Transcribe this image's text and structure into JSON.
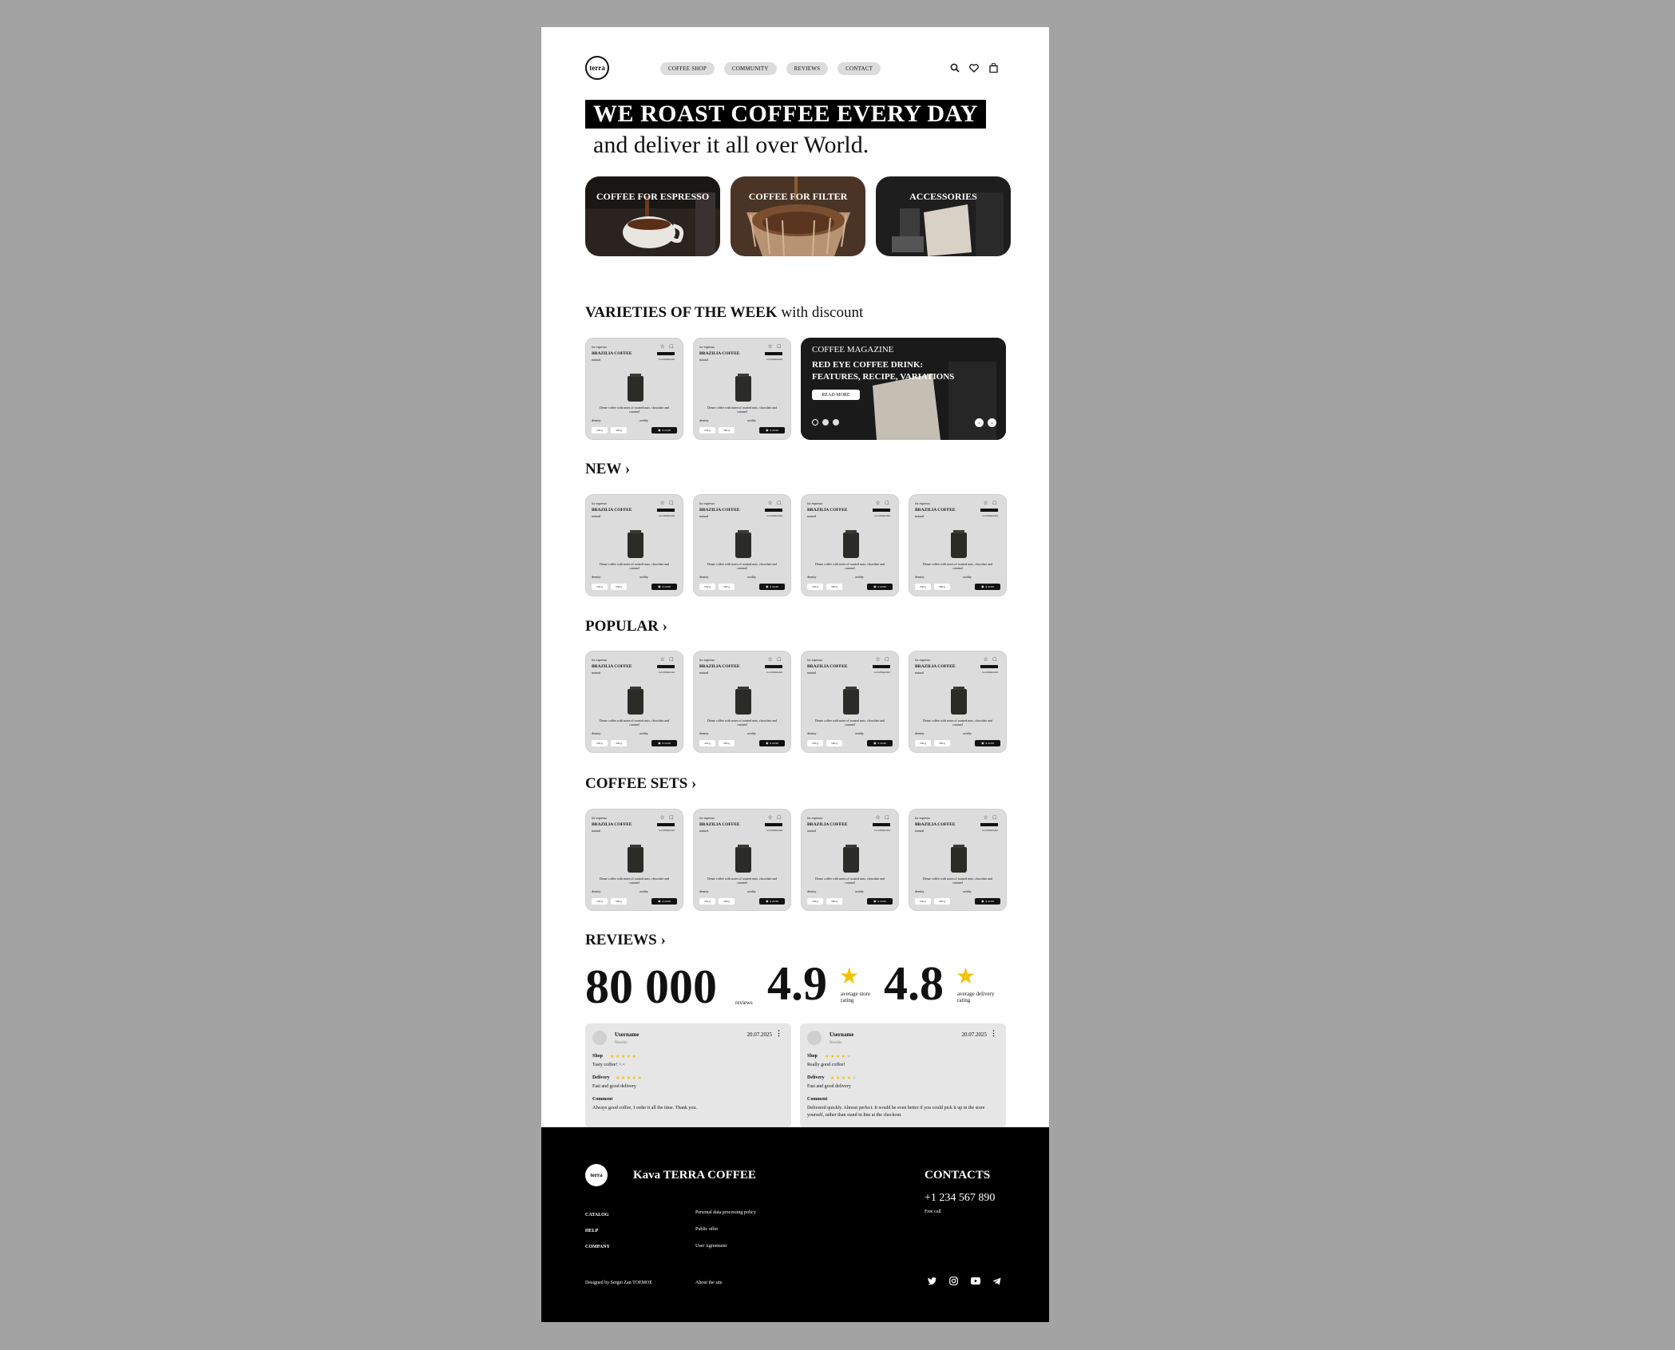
{
  "brand": {
    "logo_text": "terra"
  },
  "nav": {
    "items": [
      "COFFEE SHOP",
      "COMMUNITY",
      "REVIEWS",
      "CONTACT"
    ]
  },
  "header_icons": [
    "search-icon",
    "heart-icon",
    "bag-icon"
  ],
  "hero": {
    "title": "WE ROAST COFFEE EVERY DAY",
    "subtitle": "and deliver it all over World."
  },
  "categories": [
    {
      "label": "COFFEE FOR ESPRESSO"
    },
    {
      "label": "COFFEE FOR FILTER"
    },
    {
      "label": "ACCESSORIES"
    }
  ],
  "sections": {
    "varieties_bold": "VARIETIES OF THE WEEK",
    "varieties_light": "with discount",
    "new": "NEW",
    "popular": "POPULAR",
    "coffee_sets": "COFFEE SETS",
    "reviews": "REVIEWS"
  },
  "product": {
    "for": "for espresso",
    "name": "BRAZILIA COFFEE",
    "process": "natural",
    "recommended": "recommended",
    "description": "Dense coffee with notes of roasted nuts, chocolate and caramel",
    "spec_left": "density",
    "spec_right": "acidity",
    "weight_1": "250 g",
    "weight_2": "500 g",
    "price": "$ 24.99"
  },
  "magazine": {
    "tag": "COFFEE MAGAZINE",
    "title_1": "RED EYE COFFEE DRINK:",
    "title_2": "FEATURES, RECIPE, VARIATIONS",
    "button": "READ MORE"
  },
  "stats": {
    "reviews_count": "80 000",
    "reviews_caption": "reviews",
    "store_rating": "4.9",
    "store_caption_1": "average store",
    "store_caption_2": "rating",
    "delivery_rating": "4.8",
    "delivery_caption_1": "average delivery",
    "delivery_caption_2": "rating"
  },
  "reviews": [
    {
      "user": "Username",
      "role": "Newbie",
      "date": "20.07.2025",
      "shop_label": "Shop",
      "shop_text": "Tasty coffee! >.<",
      "delivery_label": "Delivery",
      "delivery_text": "Fast and good delivery",
      "comment_label": "Comment",
      "comment_text": "Always good coffee, I order it all the time. Thank you."
    },
    {
      "user": "Username",
      "role": "Newbie",
      "date": "20.07.2025",
      "shop_label": "Shop",
      "shop_text": "Really good coffee!",
      "delivery_label": "Delivery",
      "delivery_text": "Fast and good delivery",
      "comment_label": "Comment",
      "comment_text": "Delivered quickly. Almost perfect. It would be even better if you could pick it up in the store yourself, rather than stand in line at the checkout."
    }
  ],
  "footer": {
    "brand": "Kava TERRA COFFEE",
    "col1": [
      "CATALOG",
      "HELP",
      "COMPANY"
    ],
    "col2": [
      "Personal data processing policy",
      "Public offer",
      "User Agreement"
    ],
    "designed_by": "Designed by Sergei Zan TOEMOE",
    "about": "About the site",
    "contacts_title": "CONTACTS",
    "phone": "+1 234 567 890",
    "phone_note": "Free call",
    "social": [
      "twitter-icon",
      "instagram-icon",
      "youtube-icon",
      "telegram-icon"
    ]
  },
  "colors": {
    "accent_star": "#f2c200",
    "card_bg": "#dcdcdc",
    "footer_bg": "#000000"
  }
}
